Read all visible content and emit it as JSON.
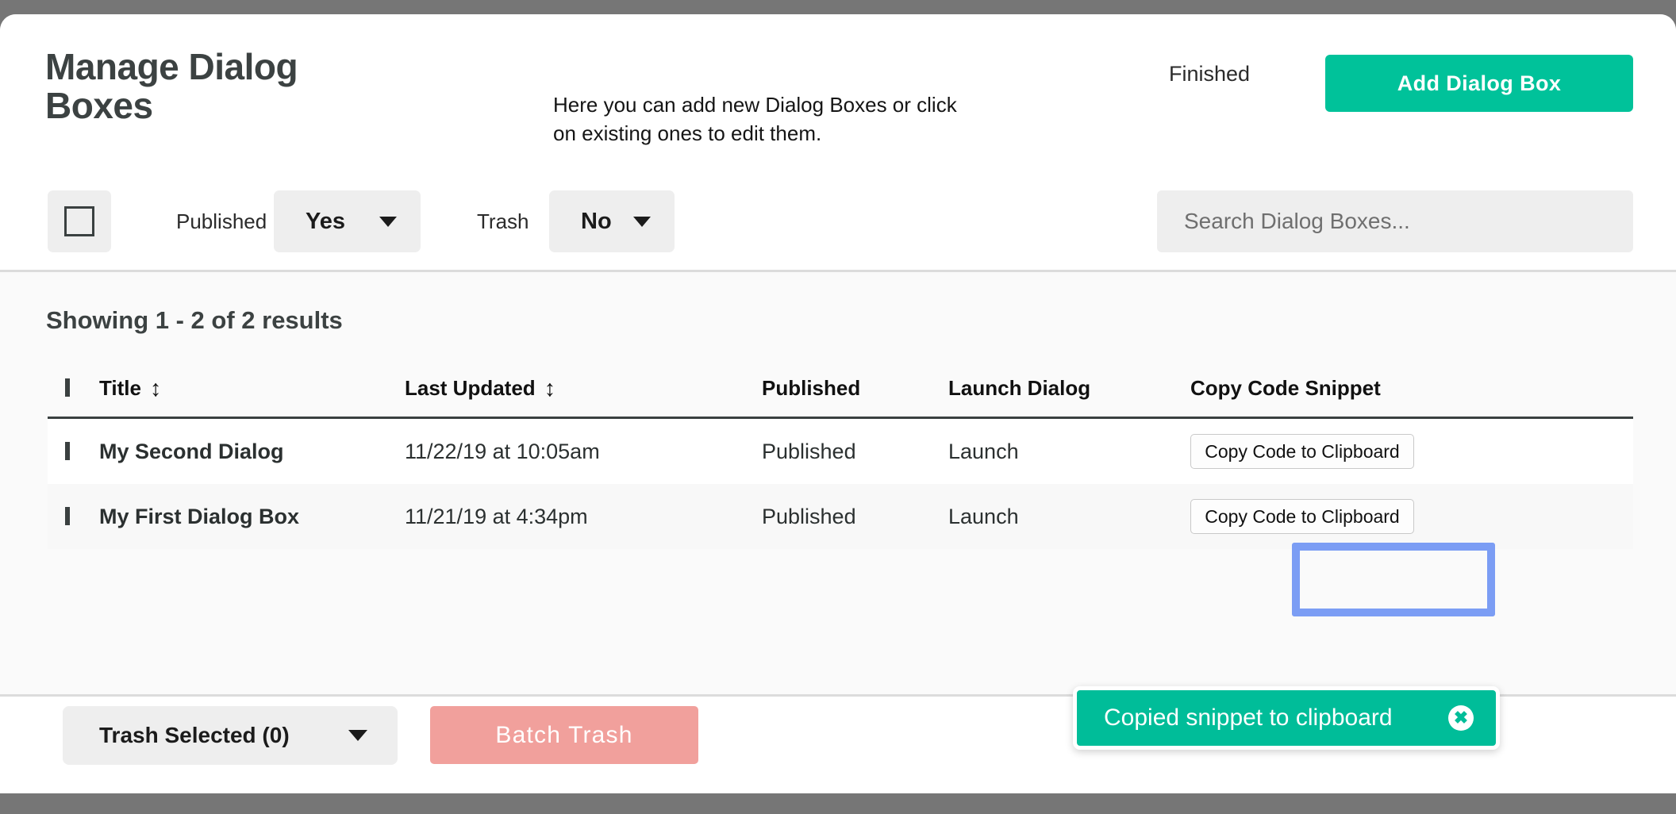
{
  "window": {
    "chrome_color": "#767676",
    "sheet_color": "#ffffff"
  },
  "header": {
    "title": "Manage Dialog Boxes",
    "subtitle": "Here you can add new Dialog Boxes or click on existing ones to edit them.",
    "status_label": "Finished",
    "add_button_label": "Add Dialog Box",
    "accent_color": "#00c29a"
  },
  "filters": {
    "select_all_checkbox": "",
    "published_label": "Published",
    "published_value": "Yes",
    "trash_label": "Trash",
    "trash_value": "No",
    "search_placeholder": "Search Dialog Boxes...",
    "search_value": ""
  },
  "results": {
    "count_text": "Showing 1 - 2 of 2 results",
    "columns": [
      {
        "key": "checkbox",
        "label": ""
      },
      {
        "key": "title",
        "label": "Title",
        "sort_icon": "↕"
      },
      {
        "key": "updated",
        "label": "Last Updated",
        "sort_icon": "↕"
      },
      {
        "key": "published",
        "label": "Published"
      },
      {
        "key": "launch",
        "label": "Launch Dialog"
      },
      {
        "key": "copy",
        "label": "Copy Code Snippet"
      }
    ],
    "rows": [
      {
        "title": "My Second Dialog",
        "updated": "11/22/19 at 10:05am",
        "published": "Published",
        "launch": "Launch",
        "copy_label": "Copy Code to Clipboard",
        "focused": false
      },
      {
        "title": "My First Dialog Box",
        "updated": "11/21/19 at 4:34pm",
        "published": "Published",
        "launch": "Launch",
        "copy_label": "Copy Code to Clipboard",
        "focused": true
      }
    ],
    "focus_ring_color": "#7b9df4"
  },
  "footer": {
    "bulk_action_value": "Trash Selected (0)",
    "batch_button_label": "Batch Trash",
    "batch_button_color": "#f1a09c"
  },
  "toast": {
    "message": "Copied snippet to clipboard",
    "close_icon": "✖",
    "background": "#00bd99"
  }
}
